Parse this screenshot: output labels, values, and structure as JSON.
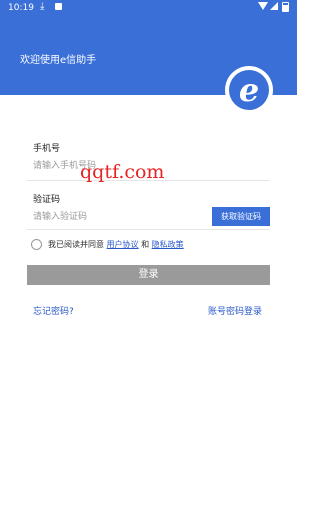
{
  "status_bar": {
    "time": "10:19",
    "download_icon": "download-icon",
    "notification_icon": "notification-icon"
  },
  "header": {
    "title": "欢迎使用e信助手",
    "logo_letter": "e"
  },
  "form": {
    "phone_label": "手机号",
    "phone_placeholder": "请输入手机号码",
    "code_label": "验证码",
    "code_placeholder": "请输入验证码",
    "get_code_button": "获取验证码"
  },
  "agreement": {
    "prefix": "我已阅读并同意",
    "user_agreement": "用户协议",
    "and": "和",
    "privacy_policy": "隐私政策"
  },
  "login_button": "登录",
  "forgot_password": "忘记密码?",
  "account_password_login": "账号密码登录",
  "watermark": "qqtf.com",
  "colors": {
    "primary": "#3a6fd8",
    "link": "#2a58c9",
    "disabled_button": "#9a9a9a",
    "watermark": "#e52424"
  }
}
